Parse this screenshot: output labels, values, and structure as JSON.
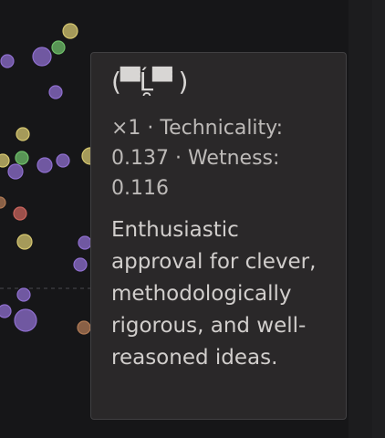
{
  "tooltip": {
    "kaomoji": "(▀̿Ĺ̯▀̿ )",
    "meta": "×1 · Technicality: 0.137 · Wetness: 0.116",
    "description": "Enthusiastic approval for clever, methodologically rigorous, and well-reasoned ideas."
  },
  "colors": {
    "background": "#161618",
    "tooltip_bg": "#2a2829",
    "tooltip_border": "#414042",
    "purple": "#8f6fcf",
    "yellow": "#d6c770",
    "green": "#6fbf6a",
    "red": "#c9645c",
    "orange": "#b07a55"
  }
}
